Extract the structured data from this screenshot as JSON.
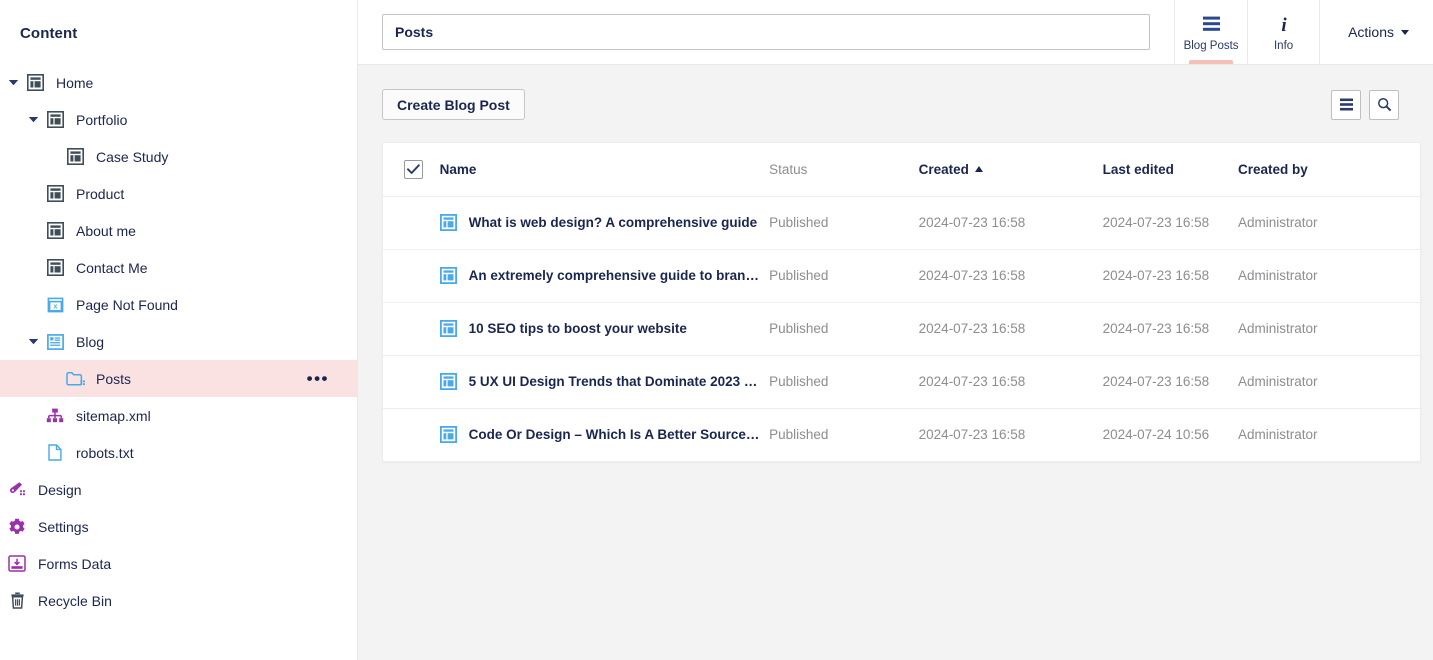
{
  "sidebar": {
    "title": "Content",
    "tree": [
      {
        "label": "Home",
        "icon": "page-icon",
        "level": 0,
        "caret": "down",
        "selected": false
      },
      {
        "label": "Portfolio",
        "icon": "page-icon",
        "level": 1,
        "caret": "down",
        "selected": false
      },
      {
        "label": "Case Study",
        "icon": "page-icon",
        "level": 2,
        "caret": "none",
        "selected": false
      },
      {
        "label": "Product",
        "icon": "page-icon",
        "level": 1,
        "caret": "none",
        "selected": false
      },
      {
        "label": "About me",
        "icon": "page-icon",
        "level": 1,
        "caret": "none",
        "selected": false
      },
      {
        "label": "Contact Me",
        "icon": "page-icon",
        "level": 1,
        "caret": "none",
        "selected": false
      },
      {
        "label": "Page Not Found",
        "icon": "page-404-icon",
        "level": 1,
        "caret": "none",
        "selected": false
      },
      {
        "label": "Blog",
        "icon": "blog-icon",
        "level": 1,
        "caret": "down",
        "selected": false
      },
      {
        "label": "Posts",
        "icon": "folder-icon",
        "level": 2,
        "caret": "none",
        "selected": true,
        "actions": "•••"
      },
      {
        "label": "sitemap.xml",
        "icon": "sitemap-icon",
        "level": 1,
        "caret": "none",
        "selected": false
      },
      {
        "label": "robots.txt",
        "icon": "file-icon",
        "level": 1,
        "caret": "none",
        "selected": false
      }
    ],
    "sections": [
      {
        "label": "Design",
        "icon": "design-icon"
      },
      {
        "label": "Settings",
        "icon": "gear-icon"
      },
      {
        "label": "Forms Data",
        "icon": "forms-icon"
      },
      {
        "label": "Recycle Bin",
        "icon": "trash-icon"
      }
    ]
  },
  "header": {
    "title_value": "Posts",
    "title_placeholder": "Enter a name...",
    "tabs": [
      {
        "label": "Blog Posts",
        "icon": "list-icon",
        "active": true
      },
      {
        "label": "Info",
        "icon": "info-icon",
        "active": false
      }
    ],
    "actions_label": "Actions"
  },
  "toolbar": {
    "create_label": "Create Blog Post",
    "list_view_icon": "list-view-icon",
    "search_icon": "search-icon"
  },
  "table": {
    "select_all_checked": true,
    "columns": [
      {
        "key": "name",
        "label": "Name",
        "sorted": false
      },
      {
        "key": "status",
        "label": "Status",
        "sorted": false,
        "muted": true
      },
      {
        "key": "created",
        "label": "Created",
        "sorted": true,
        "sort_dir": "asc"
      },
      {
        "key": "edited",
        "label": "Last edited",
        "sorted": false
      },
      {
        "key": "by",
        "label": "Created by",
        "sorted": false
      }
    ],
    "rows": [
      {
        "icon": "page-icon",
        "name": "What is web design? A comprehensive guide",
        "status": "Published",
        "created": "2024-07-23 16:58",
        "edited": "2024-07-23 16:58",
        "by": "Administrator"
      },
      {
        "icon": "page-icon",
        "name": "An extremely comprehensive guide to brandi…",
        "status": "Published",
        "created": "2024-07-23 16:58",
        "edited": "2024-07-23 16:58",
        "by": "Administrator"
      },
      {
        "icon": "page-icon",
        "name": "10 SEO tips to boost your website",
        "status": "Published",
        "created": "2024-07-23 16:58",
        "edited": "2024-07-23 16:58",
        "by": "Administrator"
      },
      {
        "icon": "page-icon",
        "name": "5 UX UI Design Trends that Dominate 2023 a…",
        "status": "Published",
        "created": "2024-07-23 16:58",
        "edited": "2024-07-23 16:58",
        "by": "Administrator"
      },
      {
        "icon": "page-icon",
        "name": "Code Or Design – Which Is A Better Source …",
        "status": "Published",
        "created": "2024-07-23 16:58",
        "edited": "2024-07-24 10:56",
        "by": "Administrator"
      }
    ]
  },
  "colors": {
    "accent_selected": "#fbe2e2",
    "tab_underline": "#f5c0b8",
    "text_primary": "#1b264f",
    "text_muted": "#8d8d92",
    "icon_blue": "#4aa9e8",
    "icon_purple": "#9b2fae",
    "page_bg": "#f4f3f3"
  }
}
